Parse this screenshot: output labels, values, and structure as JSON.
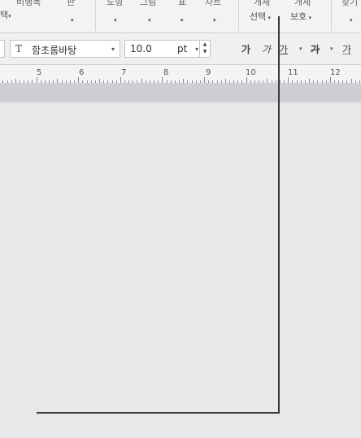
{
  "ribbon": {
    "partial_labels": [
      {
        "id": "left",
        "text": "비행목"
      },
      {
        "id": "left2",
        "text": "판"
      },
      {
        "id": "shape",
        "text": "도형"
      },
      {
        "id": "picture",
        "text": "그림"
      },
      {
        "id": "table",
        "text": "표"
      },
      {
        "id": "chart",
        "text": "차트"
      },
      {
        "id": "obj1",
        "text": "개체"
      },
      {
        "id": "obj2",
        "text": "개체"
      },
      {
        "id": "find",
        "text": "찾기"
      }
    ],
    "edge_label": "택",
    "object_select_label": "선택",
    "object_protect_label": "보호"
  },
  "toolbar": {
    "font_name": "함초롬바탕",
    "font_icon_glyph": "T",
    "font_size": "10.0",
    "font_unit": "pt",
    "bold_glyph": "가",
    "italic_glyph": "가",
    "underline_glyph": "가",
    "strike_glyph": "가",
    "color_glyph": "가"
  },
  "ruler": {
    "numbers": [
      "5",
      "6",
      "7",
      "8",
      "9",
      "10",
      "11",
      "12"
    ]
  }
}
